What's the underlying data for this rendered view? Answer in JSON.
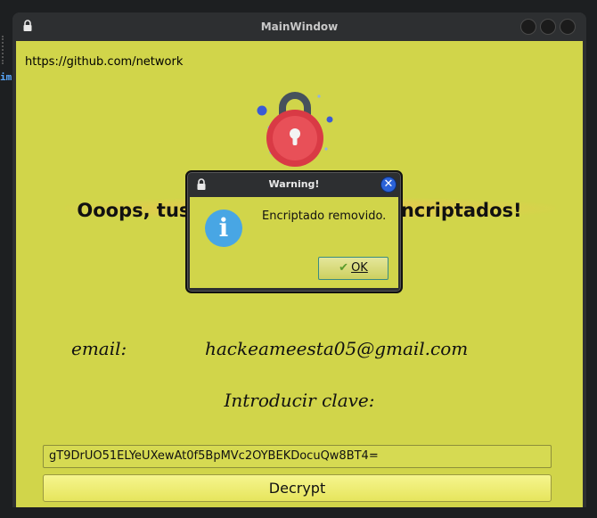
{
  "main_window": {
    "title": "MainWindow",
    "url": "https://github.com/network",
    "headline": "Ooops, tus archivos han sido encriptados!",
    "email_label": "email:",
    "email_value": "hackeameesta05@gmail.com",
    "key_label": "Introducir clave:",
    "key_value": "gT9DrUO51ELYeUXewAt0f5BpMVc2OYBEKDocuQw8BT4=",
    "decrypt_label": "Decrypt"
  },
  "dialog": {
    "title": "Warning!",
    "message": "Encriptado removido.",
    "ok_label": "OK",
    "close_symbol": "✕",
    "info_symbol": "i"
  },
  "background_terminal": {
    "fragment": "im"
  },
  "colors": {
    "window_background": "#d1d54a",
    "titlebar": "#2d2f31",
    "lock_body": "#d93a45",
    "lock_shackle": "#46515c",
    "info_icon": "#48a6e4",
    "close_button": "#2b62d8"
  },
  "icons": {
    "window_lock": "padlock-icon",
    "hero": "padlock-illustration",
    "dialog": "info-icon",
    "ok": "checkmark-icon"
  }
}
